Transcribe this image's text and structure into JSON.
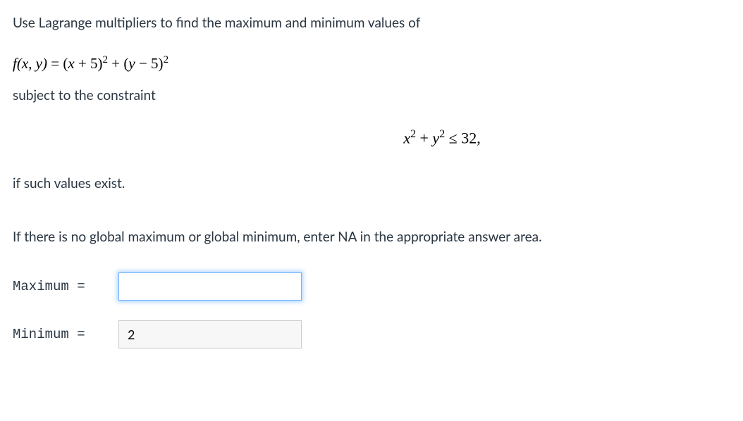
{
  "problem": {
    "intro": "Use Lagrange multipliers to find the maximum and minimum values of",
    "function_lhs": "f(x, y)",
    "function_rhs_part1": "(x + 5)",
    "function_rhs_part2": "(y − 5)",
    "exponent": "2",
    "constraint_label": "subject to the constraint",
    "constraint_lhs_x": "x",
    "constraint_lhs_y": "y",
    "constraint_op": "≤",
    "constraint_rhs": "32",
    "exist_text": "if such values exist.",
    "instruction": "If there is no global maximum or global minimum, enter NA in the appropriate answer area."
  },
  "answers": {
    "maximum_label": "Maximum =",
    "maximum_value": "",
    "minimum_label": "Minimum =",
    "minimum_value": "2"
  }
}
